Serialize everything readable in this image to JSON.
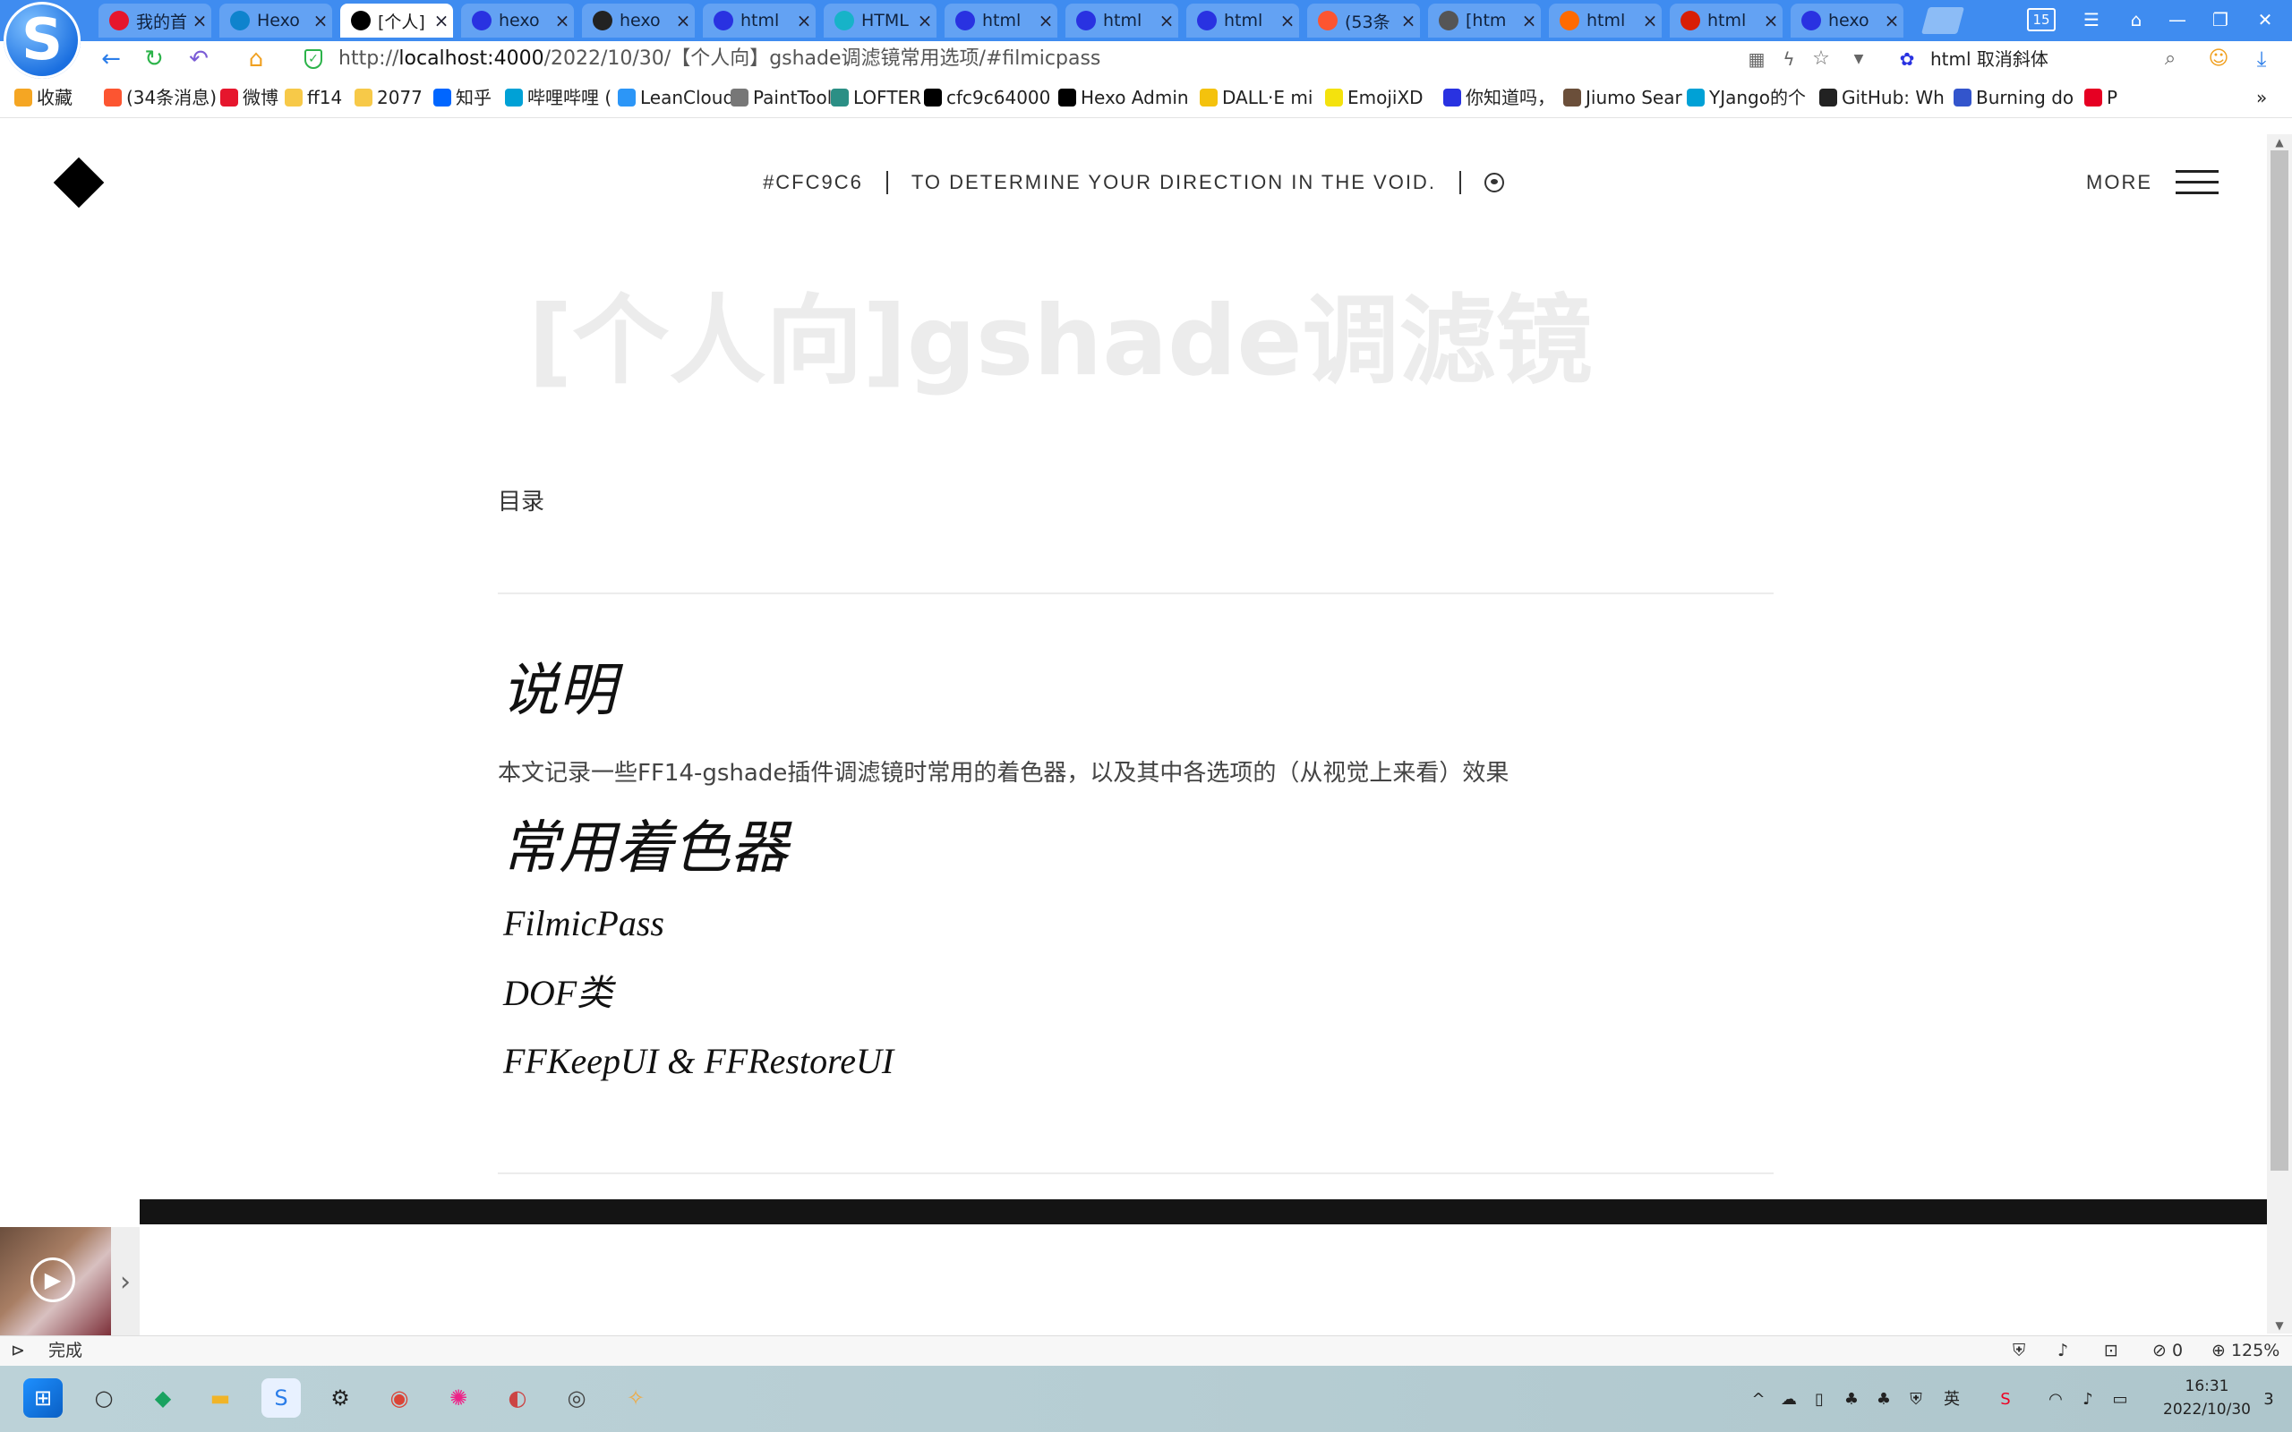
{
  "browser": {
    "tabs": [
      {
        "label": "我的首",
        "icon": "weibo-icon",
        "color": "#e6162d"
      },
      {
        "label": "Hexo",
        "icon": "hexo-icon",
        "color": "#0e83cd"
      },
      {
        "label": "[个人]",
        "icon": "diamond-icon",
        "color": "#000000"
      },
      {
        "label": "hexo",
        "icon": "baidu-paw-icon",
        "color": "#2932e1"
      },
      {
        "label": "hexo",
        "icon": "notion-icon",
        "color": "#222222"
      },
      {
        "label": "html",
        "icon": "baidu-paw-icon",
        "color": "#2932e1"
      },
      {
        "label": "HTML",
        "icon": "globe-icon",
        "color": "#17b3c8"
      },
      {
        "label": "html",
        "icon": "baidu-paw-icon",
        "color": "#2932e1"
      },
      {
        "label": "html",
        "icon": "baidu-paw-icon",
        "color": "#2932e1"
      },
      {
        "label": "html",
        "icon": "baidu-paw-icon",
        "color": "#2932e1"
      },
      {
        "label": "(53条",
        "icon": "csdn-icon",
        "color": "#fc5531"
      },
      {
        "label": "[htm",
        "icon": "blog-icon",
        "color": "#555555"
      },
      {
        "label": "html",
        "icon": "fox-icon",
        "color": "#ff6a00"
      },
      {
        "label": "html",
        "icon": "php-icon",
        "color": "#d81e06"
      },
      {
        "label": "hexo",
        "icon": "baidu-paw-icon",
        "color": "#2932e1"
      }
    ],
    "tab_count": "15",
    "url_prefix": "http://",
    "url_host": "localhost:4000",
    "url_path": "/2022/10/30/【个人向】gshade调滤镜常用选项/#filmicpass",
    "search_text": "html 取消斜体",
    "bookmarks": [
      {
        "label": "收藏",
        "icon": "star-icon",
        "color": "#f5a623"
      },
      {
        "label": "(34条消息)",
        "icon": "csdn-icon",
        "color": "#fc5531"
      },
      {
        "label": "微博",
        "icon": "weibo-icon",
        "color": "#e6162d"
      },
      {
        "label": "ff14",
        "icon": "folder-icon",
        "color": "#f7c948"
      },
      {
        "label": "2077",
        "icon": "folder-icon",
        "color": "#f7c948"
      },
      {
        "label": "知乎",
        "icon": "zhihu-icon",
        "color": "#0066ff"
      },
      {
        "label": "哔哩哔哩 (",
        "icon": "bilibili-icon",
        "color": "#00a1d6"
      },
      {
        "label": "LeanCloud",
        "icon": "leancloud-icon",
        "color": "#2c96f7"
      },
      {
        "label": "PaintTool",
        "icon": "doc-icon",
        "color": "#777777"
      },
      {
        "label": "LOFTER",
        "icon": "lofter-icon",
        "color": "#2b8f85"
      },
      {
        "label": "cfc9c64000",
        "icon": "diamond-icon",
        "color": "#000000"
      },
      {
        "label": "Hexo Admin",
        "icon": "diamond-icon",
        "color": "#000000"
      },
      {
        "label": "DALL·E mi",
        "icon": "emoji-icon",
        "color": "#f4c20d"
      },
      {
        "label": "EmojiXD",
        "icon": "emoji-icon",
        "color": "#f4e20d"
      },
      {
        "label": "你知道吗，",
        "icon": "baidu-paw-icon",
        "color": "#2932e1"
      },
      {
        "label": "Jiumo Sear",
        "icon": "jiumo-icon",
        "color": "#6b4f3a"
      },
      {
        "label": "YJango的个",
        "icon": "bilibili-icon",
        "color": "#00a1d6"
      },
      {
        "label": "GitHub: Wh",
        "icon": "github-icon",
        "color": "#222222"
      },
      {
        "label": "Burning do",
        "icon": "bd-icon",
        "color": "#3355cc"
      },
      {
        "label": "P",
        "icon": "pinterest-icon",
        "color": "#e60023"
      }
    ]
  },
  "site": {
    "nav_color_code": "#CFC9C6",
    "nav_tagline": "TO DETERMINE YOUR DIRECTION IN THE VOID.",
    "more_label": "MORE"
  },
  "post": {
    "title": "[个人向]gshade调滤镜",
    "toc_label": "目录",
    "section1_heading": "说明",
    "intro": "本文记录一些FF14-gshade插件调滤镜时常用的着色器，以及其中各选项的（从视觉上来看）效果",
    "section2_heading": "常用着色器",
    "sub1": "FilmicPass",
    "sub2": "DOF类",
    "sub3": "FFKeepUI & FFRestoreUI"
  },
  "status": {
    "left_text": "完成",
    "zoom": "125%",
    "blocked_count": "0"
  },
  "taskbar": {
    "time": "16:31",
    "date": "2022/10/30",
    "lang": "英",
    "notif_count": "3"
  }
}
